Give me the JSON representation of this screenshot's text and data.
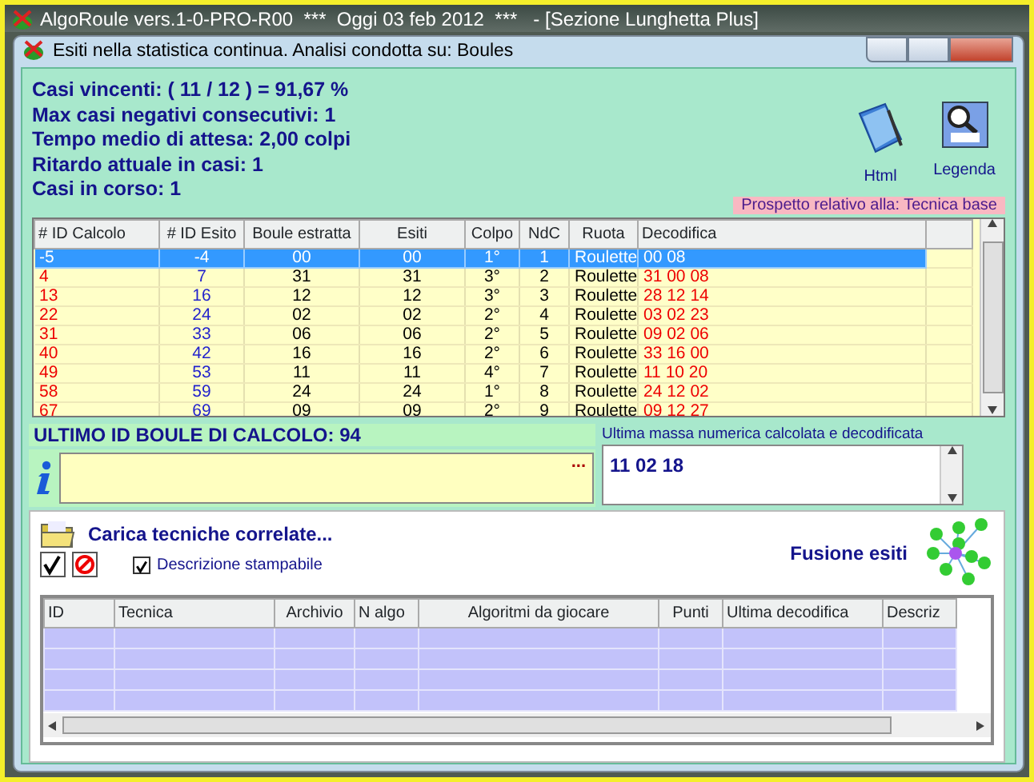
{
  "app_title": "AlgoRoule vers.1-0-PRO-R00  ***  Oggi 03 feb 2012  ***   - [Sezione Lunghetta Plus]",
  "window": {
    "title": "Esiti nella statistica continua. Analisi condotta su: Boules"
  },
  "stats": [
    "Casi vincenti: ( 11 / 12 ) = 91,67 %",
    "Max casi negativi consecutivi: 1",
    "Tempo medio di attesa: 2,00 colpi",
    "Ritardo attuale in casi: 1",
    "Casi in corso: 1"
  ],
  "tools": [
    {
      "kind": "html",
      "label": "Html"
    },
    {
      "kind": "legend",
      "label": "Legenda"
    }
  ],
  "prospetto": "Prospetto relativo alla: Tecnica base",
  "table": {
    "columns": [
      "# ID Calcolo",
      "# ID Esito",
      "Boule estratta",
      "Esiti",
      "Colpo",
      "NdC",
      "Ruota",
      "Decodifica"
    ],
    "rows": [
      {
        "selected": true,
        "cells": [
          "-5",
          "-4",
          "00",
          "00",
          "1°",
          "1",
          "Roulette",
          "00 08"
        ]
      },
      {
        "selected": false,
        "cells": [
          "4",
          "7",
          "31",
          "31",
          "3°",
          "2",
          "Roulette",
          "31 00 08"
        ]
      },
      {
        "selected": false,
        "cells": [
          "13",
          "16",
          "12",
          "12",
          "3°",
          "3",
          "Roulette",
          "28 12 14"
        ]
      },
      {
        "selected": false,
        "cells": [
          "22",
          "24",
          "02",
          "02",
          "2°",
          "4",
          "Roulette",
          "03 02 23"
        ]
      },
      {
        "selected": false,
        "cells": [
          "31",
          "33",
          "06",
          "06",
          "2°",
          "5",
          "Roulette",
          "09 02 06"
        ]
      },
      {
        "selected": false,
        "cells": [
          "40",
          "42",
          "16",
          "16",
          "2°",
          "6",
          "Roulette",
          "33 16 00"
        ]
      },
      {
        "selected": false,
        "cells": [
          "49",
          "53",
          "11",
          "11",
          "4°",
          "7",
          "Roulette",
          "11 10 20"
        ]
      },
      {
        "selected": false,
        "cells": [
          "58",
          "59",
          "24",
          "24",
          "1°",
          "8",
          "Roulette",
          "24 12 02"
        ]
      },
      {
        "selected": false,
        "cells": [
          "67",
          "69",
          "09",
          "09",
          "2°",
          "9",
          "Roulette",
          "09 12 27"
        ]
      }
    ]
  },
  "ultimo": "ULTIMO  ID BOULE DI CALCOLO: 94",
  "info_field": {
    "button": "..."
  },
  "massa": {
    "label": "Ultima massa numerica calcolata e decodificata",
    "value": "11 02 18"
  },
  "carica": "Carica tecniche correlate...",
  "descrizione": {
    "label": "Descrizione stampabile",
    "checked": true
  },
  "fusione": "Fusione esiti",
  "bottom_table": {
    "columns": [
      "ID",
      "Tecnica",
      "Archivio",
      "N algo",
      "Algoritmi da giocare",
      "Punti",
      "Ultima decodifica",
      "Descriz"
    ]
  }
}
